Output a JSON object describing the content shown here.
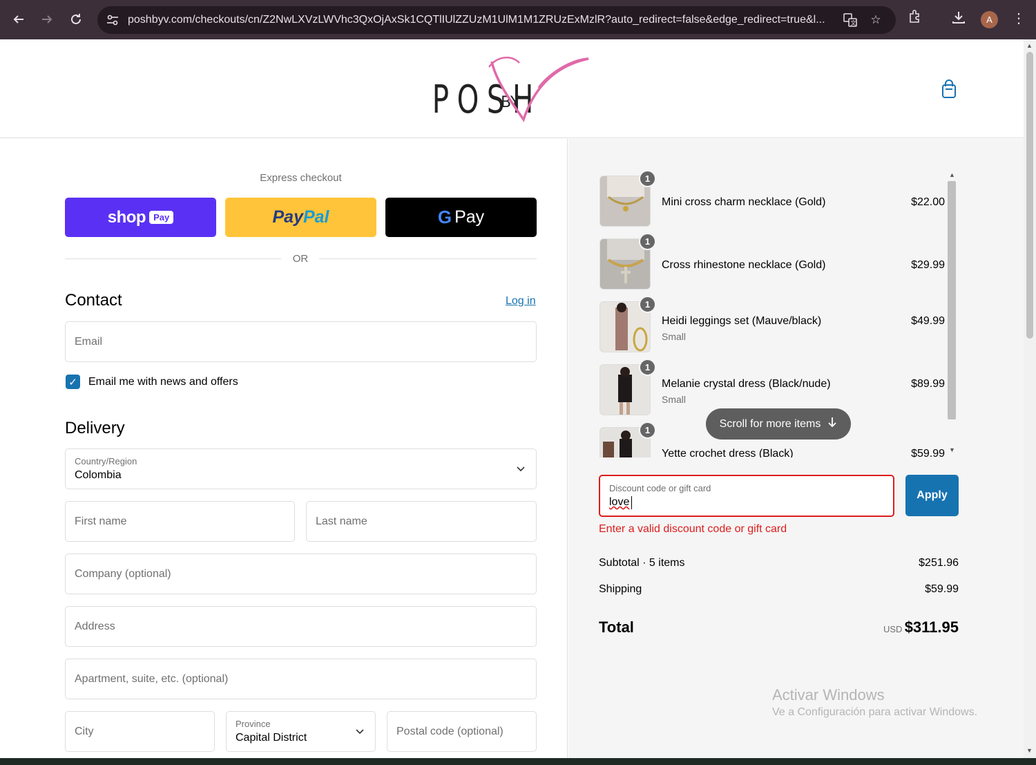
{
  "browser": {
    "url": "poshbyv.com/checkouts/cn/Z2NwLXVzLWVhc3QxOjAxSk1CQTlIUlZZUzM1UlM1M1ZRUzExMzlR?auto_redirect=false&edge_redirect=true&l...",
    "profile_initial": "A"
  },
  "brand": {
    "logo_text": "POSH",
    "logo_by": "BY",
    "logo_v": "V"
  },
  "express": {
    "title": "Express checkout",
    "shop_pay": "shop",
    "shop_pay_badge": "Pay",
    "paypal_a": "Pay",
    "paypal_b": "Pal",
    "gpay_g": "G",
    "gpay_text": "Pay",
    "or": "OR"
  },
  "contact": {
    "title": "Contact",
    "login": "Log in",
    "email_placeholder": "Email",
    "newsletter_label": "Email me with news and offers",
    "newsletter_checked": true
  },
  "delivery": {
    "title": "Delivery",
    "country_label": "Country/Region",
    "country_value": "Colombia",
    "first_name": "First name",
    "last_name": "Last name",
    "company": "Company (optional)",
    "address": "Address",
    "apartment": "Apartment, suite, etc. (optional)",
    "city": "City",
    "province_label": "Province",
    "province_value": "Capital District",
    "postal": "Postal code (optional)"
  },
  "cart": {
    "items": [
      {
        "name": "Mini cross charm necklace (Gold)",
        "variant": "",
        "price": "$22.00",
        "qty": "1"
      },
      {
        "name": "Cross rhinestone necklace (Gold)",
        "variant": "",
        "price": "$29.99",
        "qty": "1"
      },
      {
        "name": "Heidi leggings set (Mauve/black)",
        "variant": "Small",
        "price": "$49.99",
        "qty": "1"
      },
      {
        "name": "Melanie crystal dress (Black/nude)",
        "variant": "Small",
        "price": "$89.99",
        "qty": "1"
      },
      {
        "name": "Yette crochet dress (Black)",
        "variant": "",
        "price": "$59.99",
        "qty": "1"
      }
    ],
    "scroll_hint": "Scroll for more items"
  },
  "discount": {
    "label": "Discount code or gift card",
    "value": "love",
    "apply": "Apply",
    "error": "Enter a valid discount code or gift card"
  },
  "summary": {
    "subtotal_label": "Subtotal · 5 items",
    "subtotal_value": "$251.96",
    "shipping_label": "Shipping",
    "shipping_value": "$59.99",
    "total_label": "Total",
    "currency": "USD",
    "total_value": "$311.95"
  },
  "watermark": {
    "title": "Activar Windows",
    "subtitle": "Ve a Configuración para activar Windows."
  },
  "colors": {
    "accent": "#1773b0",
    "shop_pay": "#5a31f4",
    "paypal": "#ffc439",
    "error": "#dd1d1d",
    "logo_pink": "#e06aa8"
  }
}
